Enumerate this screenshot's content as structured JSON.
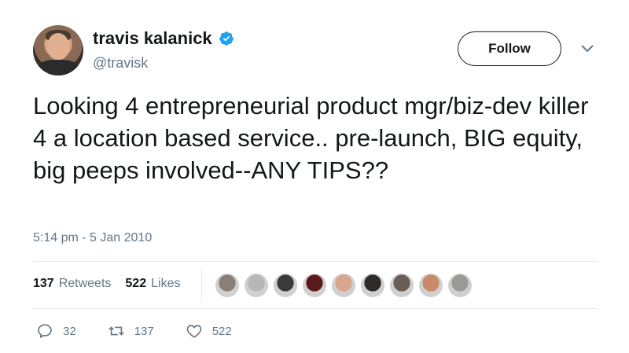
{
  "user": {
    "name": "travis kalanick",
    "handle": "@travisk",
    "verified_color": "#1da1f2"
  },
  "follow_label": "Follow",
  "tweet": {
    "text": "Looking 4 entrepreneurial product mgr/biz-dev killer 4 a location based service.. pre-launch, BIG equity, big peeps involved--ANY TIPS??",
    "timestamp": "5:14 pm - 5 Jan 2010"
  },
  "stats": {
    "retweets_count": "137",
    "retweets_label": "Retweets",
    "likes_count": "522",
    "likes_label": "Likes"
  },
  "liker_avatars": [
    {
      "color": "#8a7f78"
    },
    {
      "color": "#b9b6b3"
    },
    {
      "color": "#3a3a3a"
    },
    {
      "color": "#5a1a1a"
    },
    {
      "color": "#d8a68c"
    },
    {
      "color": "#2e2a28"
    },
    {
      "color": "#6b5e55"
    },
    {
      "color": "#c98a6a"
    },
    {
      "color": "#9a9a98"
    }
  ],
  "actions": {
    "reply_count": "32",
    "retweet_count": "137",
    "like_count": "522"
  }
}
